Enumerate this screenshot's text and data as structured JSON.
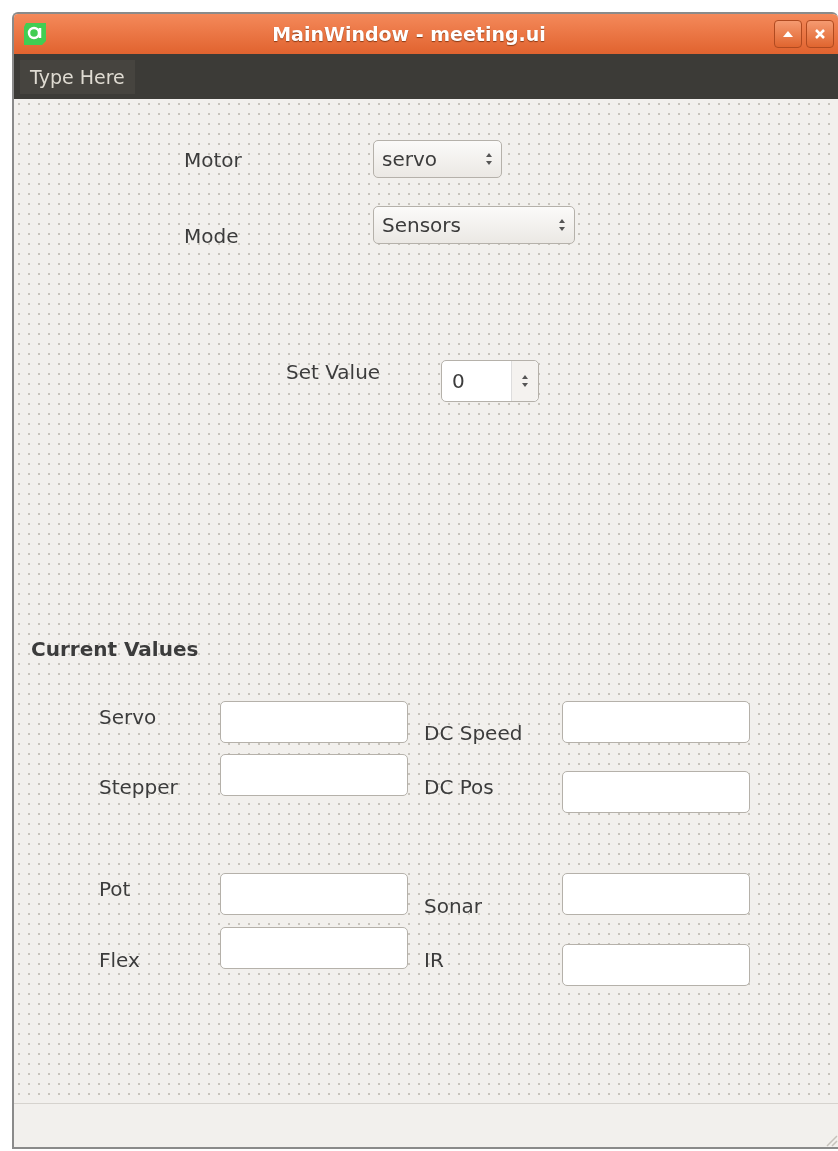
{
  "window": {
    "title": "MainWindow - meeting.ui"
  },
  "menu_bar": {
    "items": [
      "Type Here"
    ]
  },
  "controls": [
    {
      "label": "Motor",
      "kind": "combo",
      "value": "servo"
    },
    {
      "label": "Mode",
      "kind": "combo",
      "value": "Sensors"
    },
    {
      "label": "Set Value",
      "kind": "spin",
      "value": "0"
    }
  ],
  "current_values": {
    "title": "Current Values",
    "groups": [
      [
        {
          "label": "Servo"
        },
        {
          "label": "DC Speed"
        },
        {
          "label": "Stepper"
        },
        {
          "label": "DC Pos"
        }
      ],
      [
        {
          "label": "Pot"
        },
        {
          "label": "Sonar"
        },
        {
          "label": "Flex"
        },
        {
          "label": "IR"
        }
      ]
    ]
  }
}
